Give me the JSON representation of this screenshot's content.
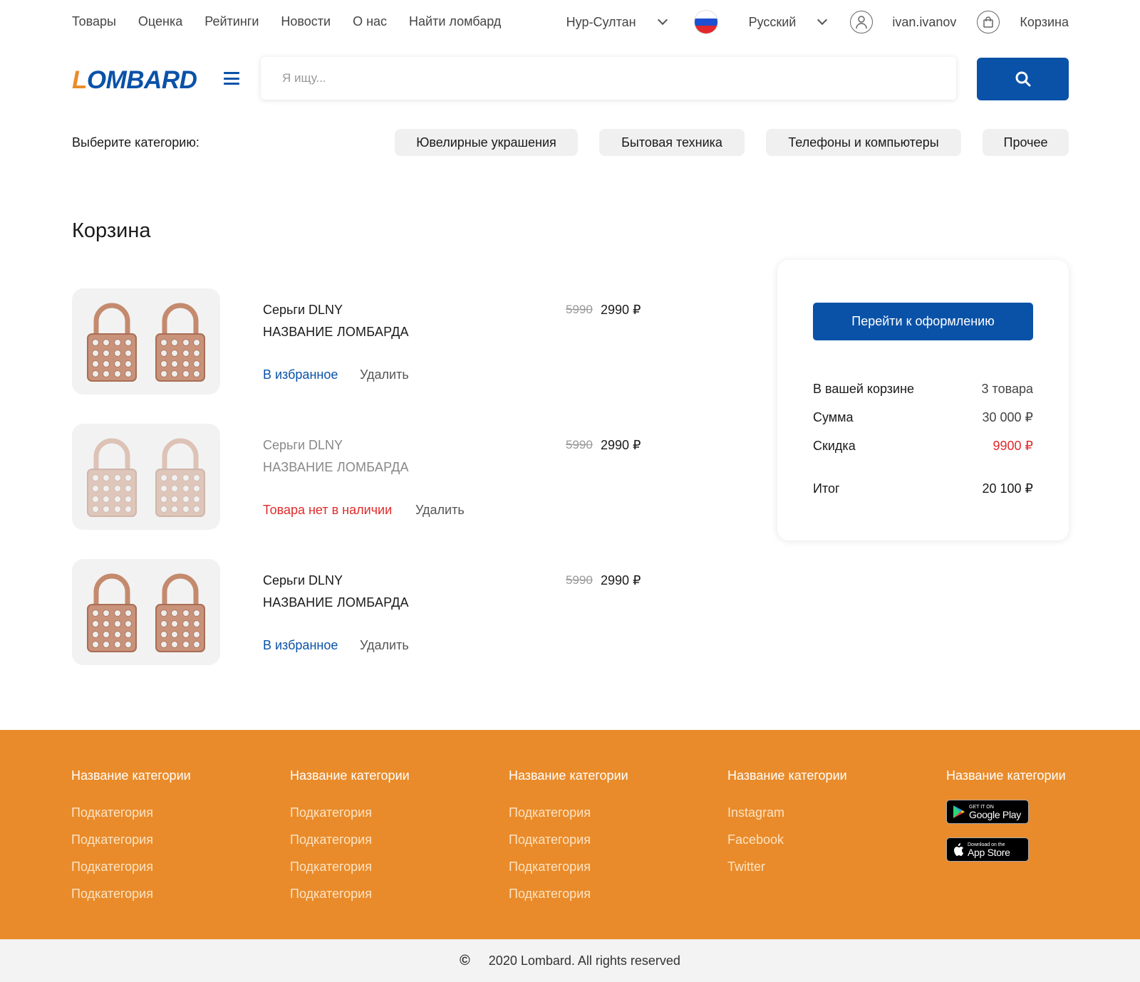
{
  "topnav": {
    "links": [
      "Товары",
      "Оценка",
      "Рейтинги",
      "Новости",
      "О нас",
      "Найти ломбард"
    ],
    "city": "Нур-Султан",
    "language": "Русский",
    "username": "ivan.ivanov",
    "cart_label": "Корзина"
  },
  "header": {
    "logo_first": "L",
    "logo_rest": "OMBARD",
    "search_placeholder": "Я ищу..."
  },
  "categories": {
    "label": "Выберите категорию:",
    "items": [
      "Ювелирные украшения",
      "Бытовая техника",
      "Телефоны и компьютеры",
      "Прочее"
    ]
  },
  "page_title": "Корзина",
  "cart_items": [
    {
      "name": "Серьги DLNY",
      "shop": "НАЗВАНИЕ ЛОМБАРДА",
      "old_price": "5990",
      "price": "2990 ₽",
      "action1": "В избранное",
      "action2": "Удалить"
    },
    {
      "name": "Серьги DLNY",
      "shop": "НАЗВАНИЕ ЛОМБАРДА",
      "old_price": "5990",
      "price": "2990 ₽",
      "action1": "Товара нет в наличии",
      "action2": "Удалить"
    },
    {
      "name": "Серьги DLNY",
      "shop": "НАЗВАНИЕ ЛОМБАРДА",
      "old_price": "5990",
      "price": "2990 ₽",
      "action1": "В избранное",
      "action2": "Удалить"
    }
  ],
  "summary": {
    "checkout_label": "Перейти к оформлению",
    "count_label": "В вашей корзине",
    "count_value": "3 товара",
    "sum_label": "Сумма",
    "sum_value": "30 000 ₽",
    "discount_label": "Скидка",
    "discount_value": "9900 ₽",
    "total_label": "Итог",
    "total_value": "20 100 ₽"
  },
  "footer": {
    "columns": [
      {
        "heading": "Название категории",
        "items": [
          "Подкатегория",
          "Подкатегория",
          "Подкатегория",
          "Подкатегория"
        ]
      },
      {
        "heading": "Название категории",
        "items": [
          "Подкатегория",
          "Подкатегория",
          "Подкатегория",
          "Подкатегория"
        ]
      },
      {
        "heading": "Название категории",
        "items": [
          "Подкатегория",
          "Подкатегория",
          "Подкатегория",
          "Подкатегория"
        ]
      },
      {
        "heading": "Название категории",
        "items": [
          "Instagram",
          "Facebook",
          "Twitter"
        ]
      },
      {
        "heading": "Название категории",
        "items": []
      }
    ],
    "google_play_small": "GET IT ON",
    "google_play_big": "Google Play",
    "app_store_small": "Download on the",
    "app_store_big": "App Store"
  },
  "copyright": {
    "symbol": "©",
    "text": "2020 Lombard. All rights reserved"
  },
  "colors": {
    "brand_blue": "#0a52a8",
    "brand_orange": "#e98b2a",
    "danger_red": "#e02a2a"
  }
}
